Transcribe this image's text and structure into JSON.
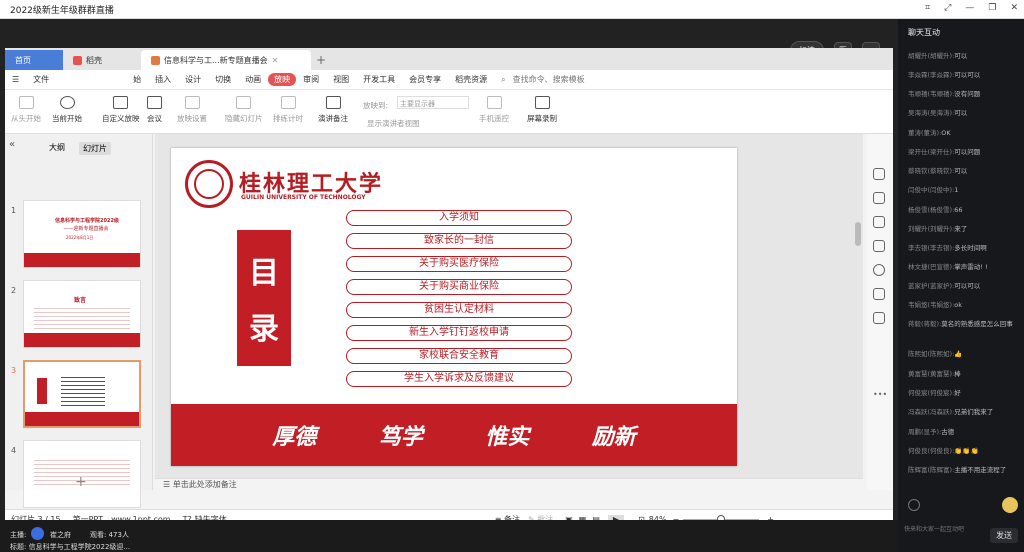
{
  "window": {
    "title": "2022级新生年级群群直播"
  },
  "stream": {
    "quality": "标清"
  },
  "wps": {
    "tabs": {
      "home": "首页",
      "daoke": "稻壳",
      "doc": "信息科学与工...新专题直播会"
    },
    "menu": [
      "文件",
      "始",
      "插入",
      "设计",
      "切换",
      "动画",
      "放映",
      "审阅",
      "视图",
      "开发工具",
      "会员专享",
      "稻壳资源",
      "查找命令、搜索模板"
    ],
    "toolbar": {
      "from_start": "从头开始",
      "from_current": "当前开始",
      "custom": "自定义放映",
      "meeting": "会议",
      "settings": "放映设置",
      "hide_slide": "隐藏幻灯片",
      "rehearse": "排练计时",
      "narrate": "演讲备注",
      "play_to": "放映到:",
      "display_sel": "主要显示器",
      "show_presenter": "显示演讲者视图",
      "remote": "手机遥控",
      "screen_rec": "屏幕录制"
    },
    "pane_tabs": {
      "outline": "大纲",
      "slides": "幻灯片"
    },
    "thumbs": [
      {
        "num": "1",
        "title": "信息科学与工程学院2022级",
        "subtitle": "——迎新专题直播会",
        "date": "2022年8月1日"
      },
      {
        "num": "2",
        "title": "致言"
      },
      {
        "num": "3"
      },
      {
        "num": "4"
      }
    ],
    "slide": {
      "uni_name": "桂林理工大学",
      "uni_name_en": "GUILIN UNIVERSITY OF TECHNOLOGY",
      "mulu": [
        "目",
        "录"
      ],
      "items": [
        "入学须知",
        "致家长的一封信",
        "关于购买医疗保险",
        "关于购买商业保险",
        "贫困生认定材料",
        "新生入学钉钉返校申请",
        "家校联合安全教育",
        "学生入学诉求及反馈建议"
      ],
      "motto": [
        "厚德",
        "笃学",
        "惟实",
        "励新"
      ],
      "motto_small": [
        "厚德",
        "笃学",
        "惟实",
        "励新"
      ]
    },
    "notes": "单击此处添加备注",
    "status": {
      "slide_pos": "幻灯片 3 / 15",
      "theme": "第一PPT，www.1ppt.com",
      "missing_font": "缺失字体",
      "notes_btn": "备注",
      "comment": "批注",
      "zoom": "84%"
    }
  },
  "cast": {
    "host_label": "主播:",
    "host_name": "崔之府",
    "viewers": "观看: 473人",
    "topic": "标题: 信息科学与工程学院2022级迎..."
  },
  "chat": {
    "title": "聊天互动",
    "messages": [
      {
        "user": "胡耀升(胡耀升):",
        "text": "可以"
      },
      {
        "user": "李焱霖(李焱霖):",
        "text": "可以可以"
      },
      {
        "user": "韦顺禧(韦顺禧):",
        "text": "没有问题"
      },
      {
        "user": "吴海涛(吴海涛):",
        "text": "可以"
      },
      {
        "user": "董涛(董涛):",
        "text": "OK"
      },
      {
        "user": "梁开仕(梁开仕):",
        "text": "可以问题"
      },
      {
        "user": "蔡晓钦(蔡晓钦):",
        "text": "可以"
      },
      {
        "user": "闫俊中(闫俊中):",
        "text": "1"
      },
      {
        "user": "杨俊雪(杨俊雪):",
        "text": "66"
      },
      {
        "user": "刘耀升(刘耀升):",
        "text": "来了"
      },
      {
        "user": "李去银(李去银):",
        "text": "多长时间啊"
      },
      {
        "user": "林文捷(巴宣德):",
        "text": "掌声雷动! !"
      },
      {
        "user": "蓝家护(蓝家护):",
        "text": "可以可以"
      },
      {
        "user": "韦娟悠(韦娟悠):",
        "text": "ok"
      },
      {
        "user": "蒋毅(蒋毅):",
        "text": "莫名的熟悉感是怎么回事"
      },
      {
        "user": "陈熙如(陈熙如):",
        "text": "👍"
      },
      {
        "user": "黄富慧(黄富慧):",
        "text": "棒"
      },
      {
        "user": "何俊宸(何俊宸):",
        "text": "好"
      },
      {
        "user": "冯森跃(冯森跃):",
        "text": "兄弟们我来了"
      },
      {
        "user": "周鹏(显予):",
        "text": "古德"
      },
      {
        "user": "何俊良(何俊良):",
        "text": "👏👏👏"
      },
      {
        "user": "陈辉富(陈辉富):",
        "text": "主播不用走流程了"
      }
    ],
    "input_placeholder": "快来和大家一起互动吧",
    "send": "发送"
  }
}
